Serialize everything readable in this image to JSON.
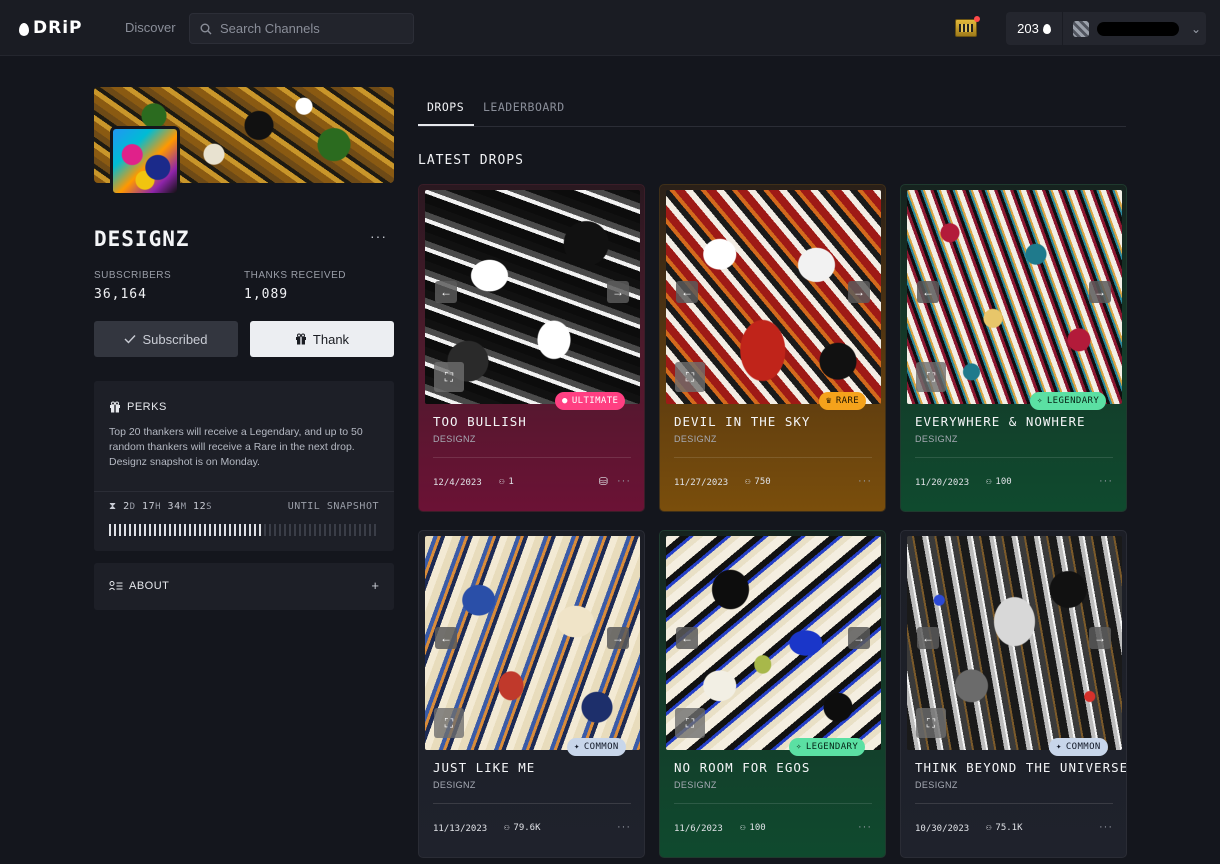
{
  "nav": {
    "logo": "DRiP",
    "discover": "Discover",
    "search_placeholder": "Search Channels",
    "balance": "203"
  },
  "channel": {
    "name": "DESIGNZ",
    "more": "···",
    "subscribers_label": "SUBSCRIBERS",
    "subscribers_value": "36,164",
    "thanks_label": "THANKS RECEIVED",
    "thanks_value": "1,089",
    "subscribed_label": "Subscribed",
    "thank_label": "Thank"
  },
  "perks": {
    "title": "PERKS",
    "text": "Top 20 thankers will receive a Legendary, and up to 50 random thankers will receive a Rare in the next drop. Designz snapshot is on Monday.",
    "timer": {
      "days": "2",
      "days_unit": "D",
      "hours": "17",
      "hours_unit": "H",
      "minutes": "34",
      "minutes_unit": "M",
      "seconds": "12",
      "seconds_unit": "S"
    },
    "until": "UNTIL SNAPSHOT",
    "progress_fraction": 0.58
  },
  "about": {
    "label": "ABOUT",
    "plus": "+"
  },
  "tabs": [
    {
      "label": "DROPS"
    },
    {
      "label": "LEADERBOARD"
    }
  ],
  "section_title": "LATEST DROPS",
  "drops": [
    {
      "title": "TOO BULLISH",
      "creator": "DESIGNZ",
      "date": "12/4/2023",
      "count": "1",
      "rarity": "ULTIMATE",
      "dots": "···"
    },
    {
      "title": "DEVIL IN THE SKY",
      "creator": "DESIGNZ",
      "date": "11/27/2023",
      "count": "750",
      "rarity": "RARE",
      "dots": "···"
    },
    {
      "title": "EVERYWHERE & NOWHERE",
      "creator": "DESIGNZ",
      "date": "11/20/2023",
      "count": "100",
      "rarity": "LEGENDARY",
      "dots": "···"
    },
    {
      "title": "JUST LIKE ME",
      "creator": "DESIGNZ",
      "date": "11/13/2023",
      "count": "79.6K",
      "rarity": "COMMON",
      "dots": "···"
    },
    {
      "title": "NO ROOM FOR EGOS",
      "creator": "DESIGNZ",
      "date": "11/6/2023",
      "count": "100",
      "rarity": "LEGENDARY",
      "dots": "···"
    },
    {
      "title": "THINK BEYOND THE UNIVERSE",
      "creator": "DESIGNZ",
      "date": "10/30/2023",
      "count": "75.1K",
      "rarity": "COMMON",
      "dots": "···"
    }
  ],
  "colors": {
    "ultimate": "#ff3f82",
    "rare": "#f5a21b",
    "legendary": "#5be0a3",
    "common": "#c8d6ea",
    "background": "#14161d"
  }
}
